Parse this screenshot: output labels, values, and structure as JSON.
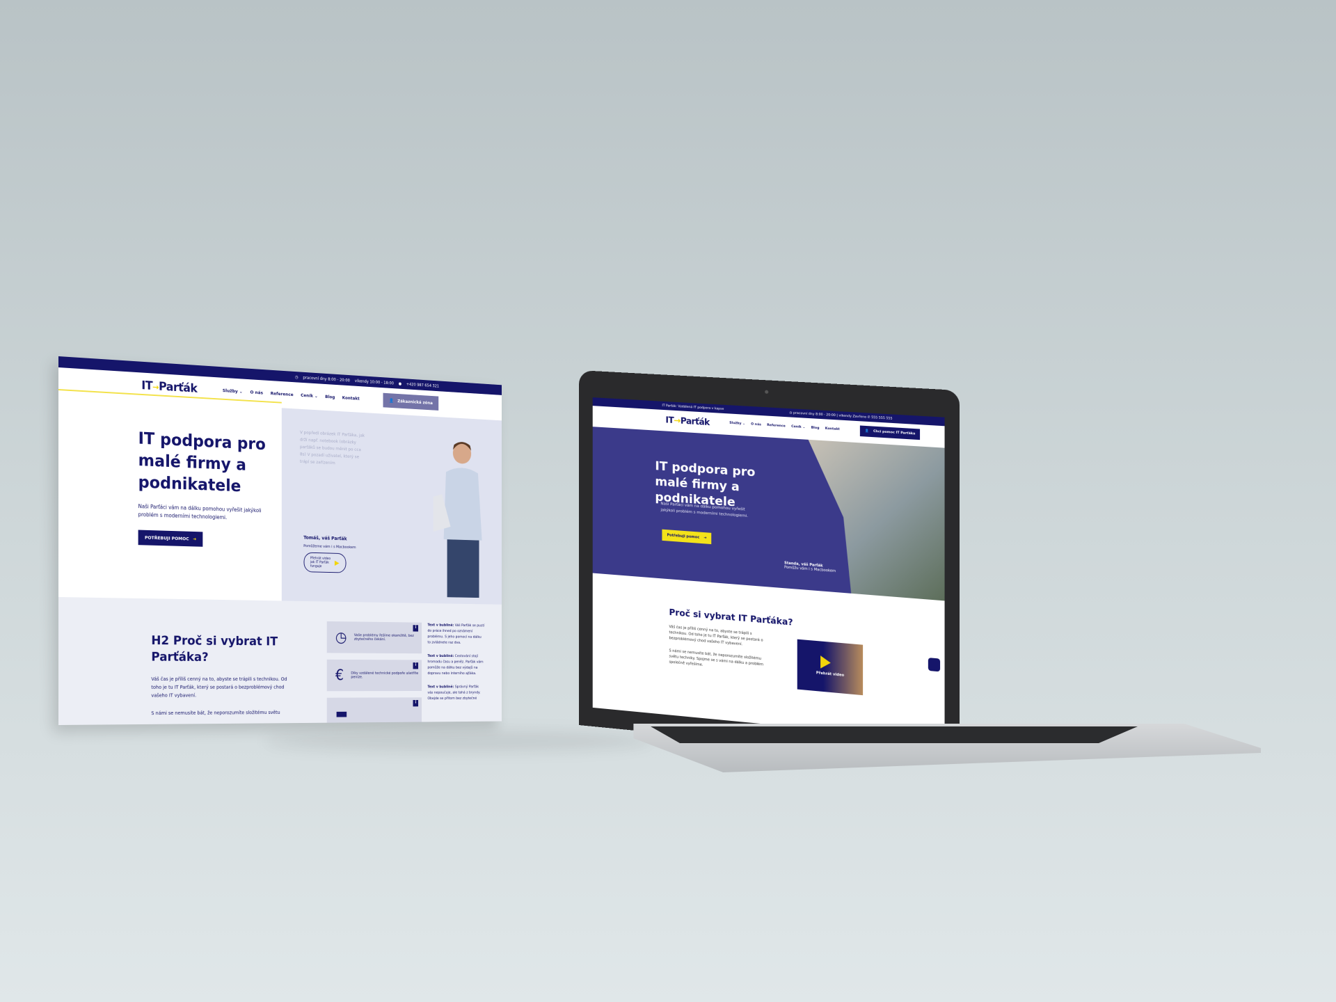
{
  "brand": {
    "logo_left": "IT",
    "logo_arrow": "→",
    "logo_right": "Parťák",
    "navy": "#15156a",
    "yellow": "#f2d50a"
  },
  "nav": [
    "Služby ⌄",
    "O nás",
    "Reference",
    "Ceník ⌄",
    "Blog",
    "Kontakt"
  ],
  "desktop": {
    "topbar": {
      "hours": "pracovní dny 8:00 - 20:00",
      "weekend": "víkendy 10:00 - 18:00",
      "phone": "+420 987 654 321"
    },
    "customer_zone": "Zákaznická zóna",
    "hero": {
      "title": "IT podpora pro malé firmy a podnikatele",
      "text": "Naši Parťáci vám na dálku pomohou vyřešit jakýkoli problém s moderními technologiemi.",
      "cta": "POTŘEBUJI POMOC",
      "placeholder_note": "V popředí obrázek IT Parťáka, jak drží např. notebook (obrázky parťáků se budou měnit po cca 8s) V pozadí uživatel, který se trápí se zařízením",
      "person_name": "Tomáš, váš Parťák",
      "person_sub": "Pomůžeme vám i s Macbookem",
      "video_btn": "Přehrát video jak IT Parťák funguje"
    },
    "why": {
      "title": "H2 Proč si vybrat IT Parťáka?",
      "p1": "Váš čas je příliš cenný na to, abyste se trápili s technikou. Od toho je tu IT Parťák, který se postará o bezproblémový chod vašeho IT vybavení.",
      "p2": "S námi se nemusíte bát, že neporozumíte složitému světu",
      "cards": [
        {
          "icon": "clock-icon",
          "glyph": "◷",
          "text": "Vaše problémy řešíme okamžitě, bez zbytečného čekání."
        },
        {
          "icon": "euro-icon",
          "glyph": "€",
          "text": "Díky vzdálené technické podpoře ušetříte peníze."
        },
        {
          "icon": "card-icon",
          "glyph": "▬",
          "text": ""
        }
      ],
      "bubbles": [
        {
          "label": "Text v bublině:",
          "text": "Váš Parťák se pustí do práce ihned po oznámení problému. S jeho pomocí na dálku to zvládnete raz dva."
        },
        {
          "label": "Text v bublině:",
          "text": "Cestování stojí hromadu času a peněz. Parťák vám pomůže na dálku bez výdajů na dopravu nebo interního ajťáka."
        },
        {
          "label": "Text v bublině:",
          "text": "Správný Parťák vás nepoučuje, ale tahá z bryndy. Obejde se přitom bez zbytečné"
        }
      ]
    }
  },
  "laptop": {
    "topbar": {
      "tagline": "IT Parťák: Vzdálená IT podpora v kapse",
      "hours": "pracovní dny 8:00 - 20:00",
      "weekend": "víkendy Zavřeno",
      "phone": "555 555 555"
    },
    "help_btn": "Chci pomoc IT Parťáka",
    "hero": {
      "title": "IT podpora pro malé firmy a podnikatele",
      "text": "Naši Parťáci vám na dálku pomohou vyřešit jakýkoli problém s moderními technologiemi.",
      "cta": "Potřebuji pomoc",
      "person_name": "Standa, váš Parťák",
      "person_sub": "Pomůžu vám i s Macbookem"
    },
    "why": {
      "title": "Proč si vybrat IT Parťáka?",
      "p1": "Váš čas je příliš cenný na to, abyste se trápili s technikou. Od toho je tu IT Parťák, který se postará o bezproblémový chod vašeho IT vybavení.",
      "p2": "S námi se nemusíte bát, že neporozumíte složitému světu techniky. Spojme se s vámi na dálku a problém společně vyřešíme.",
      "video": "Přehrát video"
    }
  }
}
